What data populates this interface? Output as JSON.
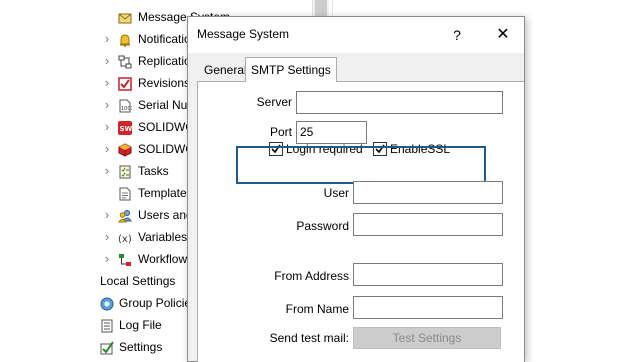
{
  "tree": {
    "items": [
      {
        "label": "Message System",
        "icon": "envelope-icon",
        "expandable": false
      },
      {
        "label": "Notificatio",
        "icon": "bell-icon",
        "expandable": true
      },
      {
        "label": "Replicatio",
        "icon": "replication-icon",
        "expandable": true
      },
      {
        "label": "Revisions",
        "icon": "checkbox-red-icon",
        "expandable": true
      },
      {
        "label": "Serial Nur",
        "icon": "serial-number-icon",
        "expandable": true
      },
      {
        "label": "SOLIDWO",
        "icon": "solidworks-icon",
        "expandable": true
      },
      {
        "label": "SOLIDWO",
        "icon": "solidworks-cube-icon",
        "expandable": true
      },
      {
        "label": "Tasks",
        "icon": "tasks-icon",
        "expandable": true
      },
      {
        "label": "Template",
        "icon": "template-icon",
        "expandable": false
      },
      {
        "label": "Users and",
        "icon": "users-icon",
        "expandable": true
      },
      {
        "label": "Variables",
        "icon": "variable-icon",
        "expandable": true
      },
      {
        "label": "Workflow",
        "icon": "workflow-icon",
        "expandable": true
      }
    ],
    "section_label": "Local Settings",
    "section_items": [
      {
        "label": "Group Policie",
        "icon": "group-policy-icon"
      },
      {
        "label": "Log File",
        "icon": "log-file-icon"
      },
      {
        "label": "Settings",
        "icon": "settings-check-icon"
      }
    ]
  },
  "dialog": {
    "title": "Message System",
    "help_label": "?",
    "close_label": "✕",
    "tabs": [
      {
        "label": "General",
        "active": false
      },
      {
        "label": "SMTP Settings",
        "active": true
      }
    ],
    "fields": {
      "server": {
        "label": "Server",
        "value": ""
      },
      "port": {
        "label": "Port",
        "value": "25"
      },
      "user": {
        "label": "User",
        "value": ""
      },
      "password": {
        "label": "Password",
        "value": ""
      },
      "from_address": {
        "label": "From Address",
        "value": ""
      },
      "from_name": {
        "label": "From Name",
        "value": ""
      },
      "send_test_mail": {
        "label": "Send test mail:"
      }
    },
    "checkboxes": {
      "login_required": {
        "label": "Login required",
        "checked": true
      },
      "enable_ssl": {
        "label": "EnableSSL",
        "checked": true
      }
    },
    "test_button_label": "Test Settings"
  },
  "colors": {
    "highlight_border": "#1f5a8a",
    "dialog_bg": "#f0f0f0",
    "disabled_button": "#cccccc"
  }
}
